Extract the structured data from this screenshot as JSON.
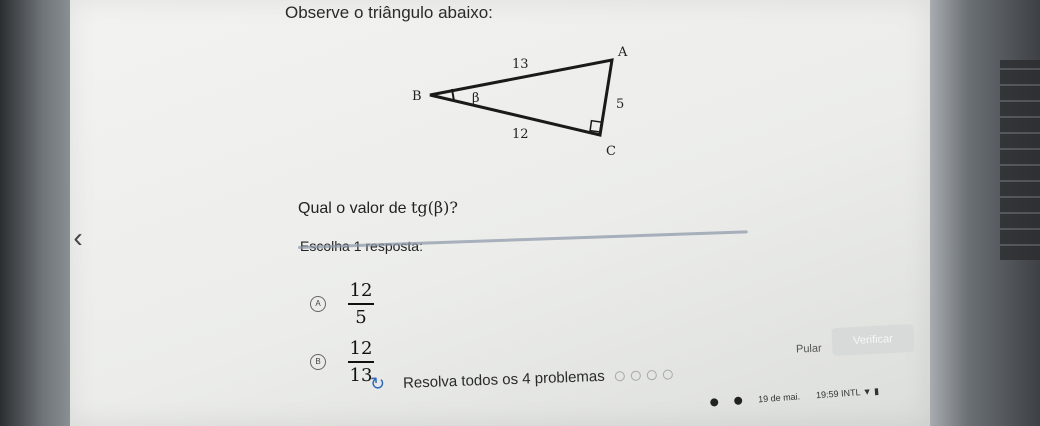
{
  "prompt": "Observe o triângulo abaixo:",
  "triangle": {
    "vertices": {
      "a": "A",
      "b": "B",
      "c": "C"
    },
    "angle_label": "β",
    "sides": {
      "hypotenuse": "13",
      "opposite": "5",
      "adjacent": "12"
    }
  },
  "question": {
    "prefix": "Qual o valor de",
    "expression": "tg(β)?"
  },
  "choose_label": "Escolha 1 resposta:",
  "options": [
    {
      "badge": "A",
      "numerator": "12",
      "denominator": "5"
    },
    {
      "badge": "B",
      "numerator": "12",
      "denominator": "13"
    }
  ],
  "footer": {
    "text": "Resolva todos os 4 problemas",
    "problem_count": 4
  },
  "buttons": {
    "skip": "Pular",
    "check": "Verificar"
  },
  "taskbar": {
    "date": "19 de mai.",
    "time": "19:59",
    "locale": "INTL"
  }
}
